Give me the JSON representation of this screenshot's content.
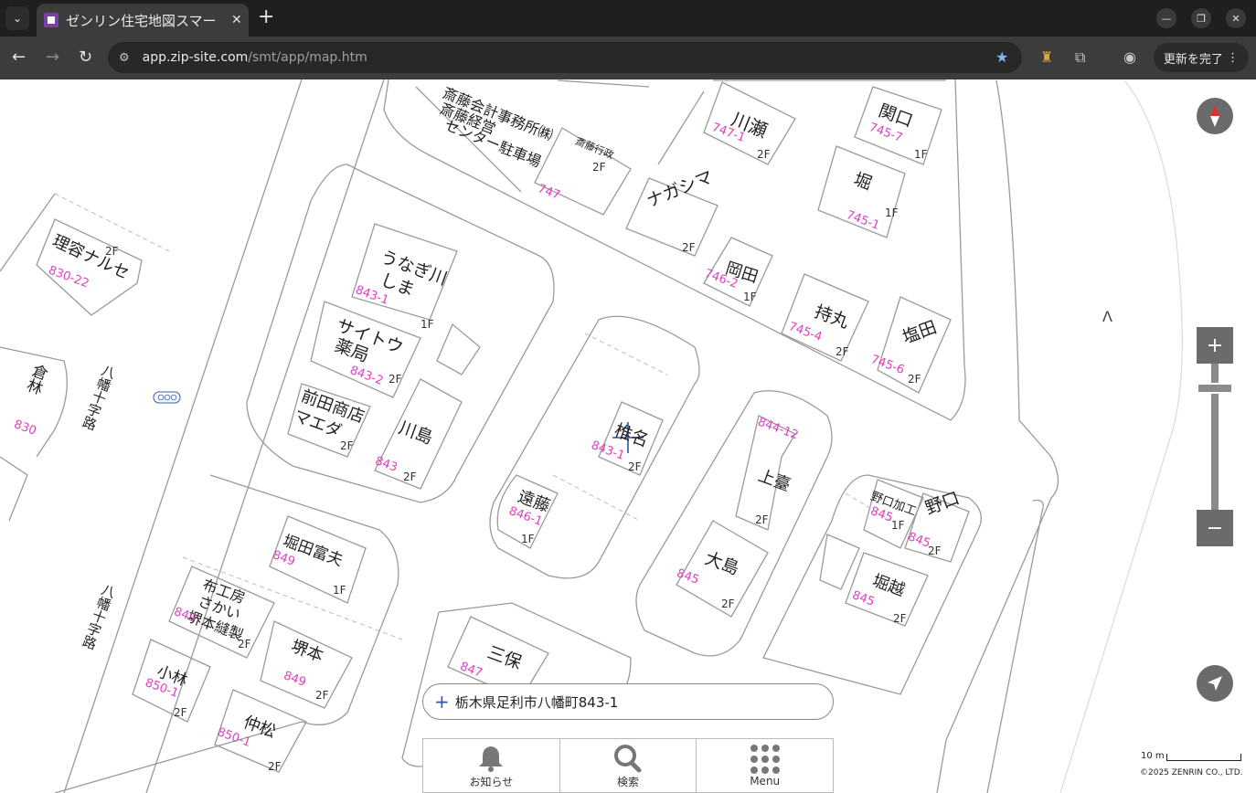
{
  "browser": {
    "tab_title": "ゼンリン住宅地図スマー",
    "url_host": "app.zip-site.com",
    "url_path": "/smt/app/map.htm",
    "update_label": "更新を完了",
    "tab_close": "✕",
    "new_tab": "+",
    "tab_list": "⌄"
  },
  "map": {
    "labels": [
      {
        "id": "saito-kaikei",
        "text": "斎藤会計事務所㈱"
      },
      {
        "id": "saito-keiei",
        "text": "斎藤経営"
      },
      {
        "id": "center-parking",
        "text": "センター駐車場"
      },
      {
        "id": "saito-gyosei",
        "text": "斎藤行政"
      },
      {
        "id": "kawase",
        "text": "川瀬"
      },
      {
        "id": "sekiguchi",
        "text": "関口"
      },
      {
        "id": "hori",
        "text": "堀"
      },
      {
        "id": "nagashima",
        "text": "ナガシマ"
      },
      {
        "id": "okada",
        "text": "岡田"
      },
      {
        "id": "mochimaru",
        "text": "持丸"
      },
      {
        "id": "shioda",
        "text": "塩田"
      },
      {
        "id": "riyou",
        "text": "理容ナルセ"
      },
      {
        "id": "unagi",
        "text": "うなぎ川"
      },
      {
        "id": "shima",
        "text": "しま"
      },
      {
        "id": "saito-yakkyoku",
        "text": "サイトウ"
      },
      {
        "id": "yakkyoku",
        "text": "薬局"
      },
      {
        "id": "maeda",
        "text": "前田商店"
      },
      {
        "id": "maeda2",
        "text": "マエダ"
      },
      {
        "id": "kawashima",
        "text": "川島"
      },
      {
        "id": "shiina",
        "text": "椎名"
      },
      {
        "id": "endo",
        "text": "遠藤"
      },
      {
        "id": "kami",
        "text": "上臺"
      },
      {
        "id": "oshima",
        "text": "大島"
      },
      {
        "id": "noguchi-kako",
        "text": "野口加工"
      },
      {
        "id": "noguchi",
        "text": "野口"
      },
      {
        "id": "horikoshi",
        "text": "堀越"
      },
      {
        "id": "horita",
        "text": "堀田富夫"
      },
      {
        "id": "nunokobo",
        "text": "布工房"
      },
      {
        "id": "sakai",
        "text": "さかい"
      },
      {
        "id": "sakaihousei",
        "text": "堺本縫製"
      },
      {
        "id": "sakaimoto",
        "text": "堺本"
      },
      {
        "id": "kobayashi",
        "text": "小林"
      },
      {
        "id": "nakamatsu",
        "text": "仲松"
      },
      {
        "id": "mitsuho",
        "text": "三保"
      },
      {
        "id": "kurabayashi",
        "text": "倉林"
      },
      {
        "id": "bus1",
        "text": "八幡十字路"
      },
      {
        "id": "bus2",
        "text": "八幡十字路"
      }
    ],
    "lot_numbers": [
      "747-1",
      "745-7",
      "745-1",
      "746-2",
      "745-4",
      "745-6",
      "747",
      "830-22",
      "843-1",
      "843-2",
      "843",
      "843-1",
      "846-1",
      "844-12",
      "845",
      "845",
      "845",
      "845",
      "849",
      "849",
      "849",
      "850-1",
      "850-1",
      "847",
      "830"
    ],
    "floors": [
      "2F",
      "1F",
      "1F",
      "2F",
      "2F",
      "1F",
      "2F",
      "2F",
      "2F",
      "1F",
      "2F",
      "2F",
      "2F",
      "2F",
      "2F",
      "1F",
      "2F",
      "1F",
      "2F",
      "2F",
      "1F",
      "2F",
      "2F",
      "2F",
      "2F"
    ]
  },
  "controls": {
    "zoom_in": "+",
    "zoom_out": "−",
    "zoom_level": 0.87
  },
  "search": {
    "address": "栃木県足利市八幡町843-1"
  },
  "bottom_nav": {
    "notice": "お知らせ",
    "search": "検索",
    "menu": "Menu"
  },
  "scale": {
    "label": "10 m",
    "copyright": "©2025 ZENRIN CO., LTD."
  },
  "colors": {
    "lot_number": "#e040c0",
    "control": "#6b6b6b",
    "chrome_bg": "#1f1f1f"
  }
}
